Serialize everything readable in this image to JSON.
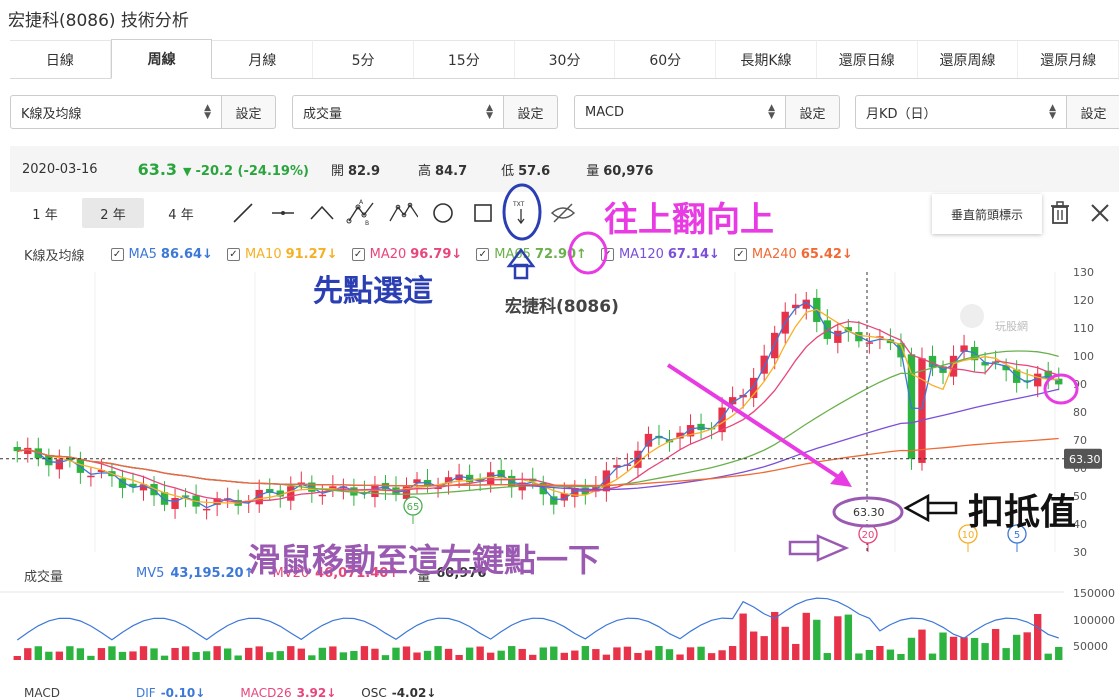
{
  "page": {
    "title": "宏捷科(8086) 技術分析"
  },
  "period_tabs": [
    {
      "label": "日線",
      "active": false
    },
    {
      "label": "周線",
      "active": true
    },
    {
      "label": "月線",
      "active": false
    },
    {
      "label": "5分",
      "active": false
    },
    {
      "label": "15分",
      "active": false
    },
    {
      "label": "30分",
      "active": false
    },
    {
      "label": "60分",
      "active": false
    },
    {
      "label": "長期K線",
      "active": false
    },
    {
      "label": "還原日線",
      "active": false
    },
    {
      "label": "還原周線",
      "active": false
    },
    {
      "label": "還原月線",
      "active": false
    }
  ],
  "selectors": [
    {
      "value": "K線及均線",
      "button": "設定"
    },
    {
      "value": "成交量",
      "button": "設定"
    },
    {
      "value": "MACD",
      "button": "設定"
    },
    {
      "value": "月KD（日）",
      "button": "設定"
    }
  ],
  "quote": {
    "date": "2020-03-16",
    "price": "63.3",
    "change": "-20.2 (-24.19%)",
    "open_label": "開",
    "open": "82.9",
    "high_label": "高",
    "high": "84.7",
    "low_label": "低",
    "low": "57.6",
    "vol_label": "量",
    "vol": "60,976"
  },
  "range_buttons": [
    {
      "label": "1 年",
      "active": false
    },
    {
      "label": "2 年",
      "active": true
    },
    {
      "label": "4 年",
      "active": false
    }
  ],
  "tools": [
    "line-tool-icon",
    "horizontal-line-icon",
    "angle-icon",
    "abc-pattern-icon",
    "abcd-pattern-icon",
    "circle-icon",
    "rectangle-icon",
    "txt-arrow-icon",
    "hide-eye-icon"
  ],
  "txt_tool_label": "TXT",
  "vertical_arrow_label": "垂直箭頭標示",
  "ma_legend": {
    "title": "K線及均線",
    "items": [
      {
        "name": "MA5",
        "value": "86.64↓",
        "color": "#3c78d8"
      },
      {
        "name": "MA10",
        "value": "91.27↓",
        "color": "#f6b026"
      },
      {
        "name": "MA20",
        "value": "96.79↓",
        "color": "#e8457a"
      },
      {
        "name": "MA65",
        "value": "72.90↑",
        "color": "#6ab04c"
      },
      {
        "name": "MA120",
        "value": "67.14↓",
        "color": "#7b4fd8"
      },
      {
        "name": "MA240",
        "value": "65.42↓",
        "color": "#f06a35"
      }
    ]
  },
  "chart": {
    "watermark": "宏捷科(8086)",
    "logo_text": "玩股網",
    "price_axis": [
      "130",
      "120",
      "110",
      "100",
      "90",
      "80",
      "70",
      "60",
      "50",
      "40",
      "30"
    ],
    "current_price_tag": "63.30",
    "crosshair_label": "63.30",
    "markers": [
      {
        "label": "65",
        "color": "#4caf50"
      },
      {
        "label": "20",
        "color": "#e8457a"
      },
      {
        "label": "10",
        "color": "#f6b026"
      },
      {
        "label": "5",
        "color": "#3c78d8"
      }
    ]
  },
  "volume": {
    "title": "成交量",
    "mv5_label": "MV5",
    "mv5": "43,195.20↑",
    "mv20_label": "MV20",
    "mv20": "46,071.40↑",
    "vol_label": "量",
    "vol": "60,976",
    "axis": [
      "150000",
      "100000",
      "50000"
    ]
  },
  "macd": {
    "title": "MACD",
    "dif_label": "DIF",
    "dif": "-0.10↓",
    "macd_label": "MACD26",
    "macd": "3.92↓",
    "osc_label": "OSC",
    "osc": "-4.02↓"
  },
  "annotations": {
    "click_first": "先點選這",
    "flip_up": "往上翻向上",
    "mouse_move": "滑鼠移動至這左鍵點一下",
    "deduction": "扣抵值"
  },
  "colors": {
    "up": "#e8324a",
    "down": "#2db33f",
    "accent": "#2b3fb3",
    "annotation": "#e83be3"
  }
}
